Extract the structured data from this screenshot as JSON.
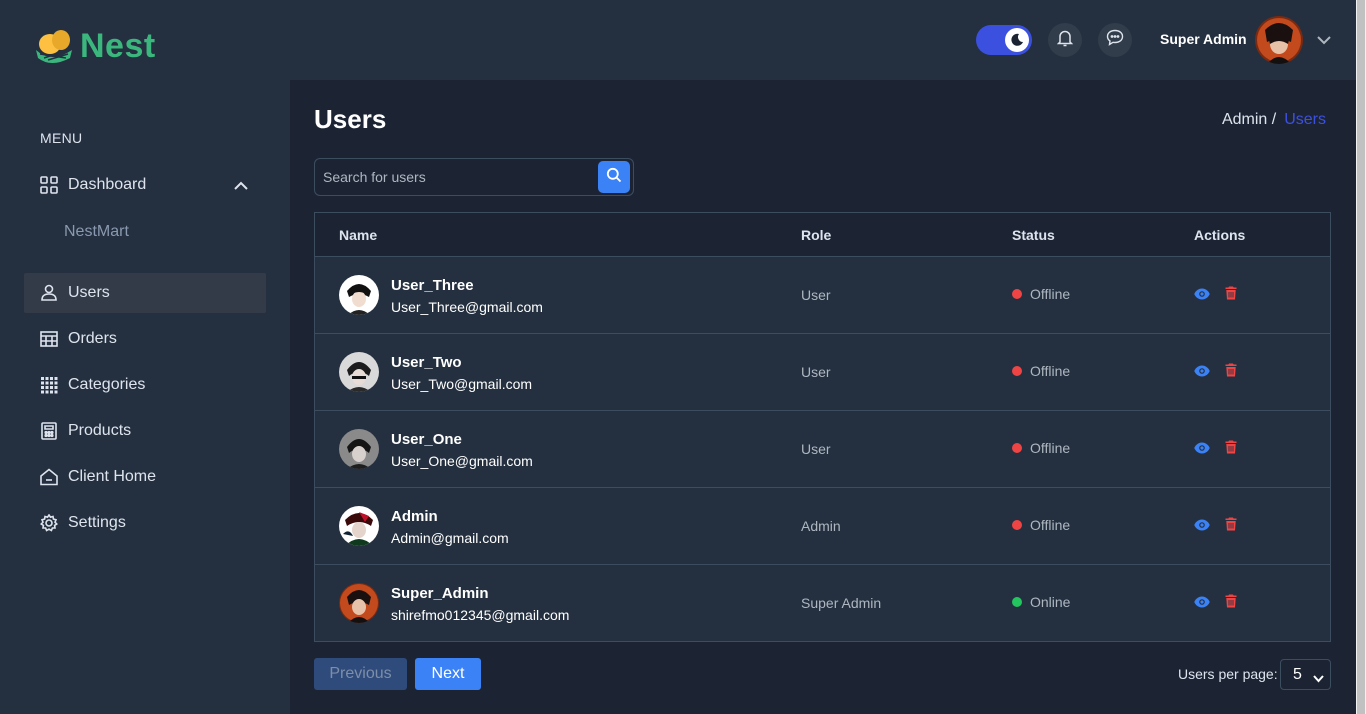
{
  "app": {
    "name": "Nest"
  },
  "sidebar": {
    "menu_heading": "MENU",
    "dashboard": {
      "label": "Dashboard",
      "icon": "grid-icon",
      "expanded": true,
      "submenu": [
        "NestMart"
      ]
    },
    "items": [
      {
        "label": "Users",
        "icon": "user-icon",
        "active": true
      },
      {
        "label": "Orders",
        "icon": "table-icon",
        "active": false
      },
      {
        "label": "Categories",
        "icon": "dots-grid-icon",
        "active": false
      },
      {
        "label": "Products",
        "icon": "calculator-icon",
        "active": false
      },
      {
        "label": "Client Home",
        "icon": "home-icon",
        "active": false
      },
      {
        "label": "Settings",
        "icon": "gear-icon",
        "active": false
      }
    ]
  },
  "header": {
    "dark_mode": true,
    "user_name": "Super Admin"
  },
  "page": {
    "title": "Users",
    "breadcrumb": {
      "parent": "Admin /",
      "current": "Users"
    }
  },
  "search": {
    "placeholder": "Search for users",
    "value": ""
  },
  "table": {
    "headers": {
      "name": "Name",
      "role": "Role",
      "status": "Status",
      "actions": "Actions"
    },
    "rows": [
      {
        "name": "User_Three",
        "email": "User_Three@gmail.com",
        "role": "User",
        "status": "Offline"
      },
      {
        "name": "User_Two",
        "email": "User_Two@gmail.com",
        "role": "User",
        "status": "Offline"
      },
      {
        "name": "User_One",
        "email": "User_One@gmail.com",
        "role": "User",
        "status": "Offline"
      },
      {
        "name": "Admin",
        "email": "Admin@gmail.com",
        "role": "Admin",
        "status": "Offline"
      },
      {
        "name": "Super_Admin",
        "email": "shirefmo012345@gmail.com",
        "role": "Super Admin",
        "status": "Online"
      }
    ]
  },
  "pagination": {
    "previous_label": "Previous",
    "next_label": "Next",
    "per_page_label": "Users per page:",
    "per_page_value": "5"
  },
  "colors": {
    "accent": "#3c50e0",
    "brand": "#3bb77e",
    "offline": "#ef4444",
    "online": "#22c55e",
    "delete": "#ef4444",
    "view": "#3b82f6"
  }
}
